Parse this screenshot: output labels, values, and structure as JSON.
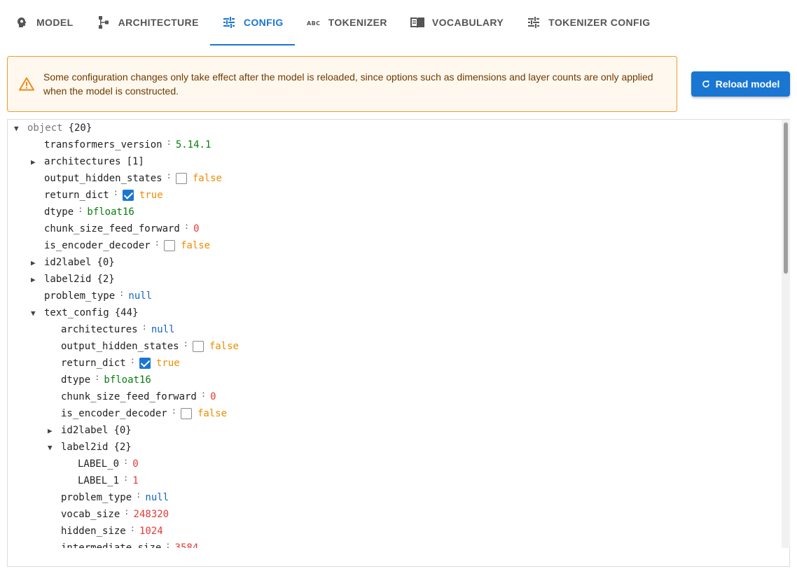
{
  "tabs": [
    {
      "label": "MODEL",
      "icon": "head-gear-icon",
      "active": false
    },
    {
      "label": "ARCHITECTURE",
      "icon": "architecture-icon",
      "active": false
    },
    {
      "label": "CONFIG",
      "icon": "tune-icon",
      "active": true
    },
    {
      "label": "TOKENIZER",
      "icon": "abc-icon",
      "active": false
    },
    {
      "label": "VOCABULARY",
      "icon": "book-icon",
      "active": false
    },
    {
      "label": "TOKENIZER CONFIG",
      "icon": "tune-icon",
      "active": false
    }
  ],
  "warning": {
    "icon": "warning-icon",
    "text": "Some configuration changes only take effect after the model is reloaded, since options such as dimensions and layer counts are only applied when the model is constructed."
  },
  "reload_button": {
    "label": "Reload model",
    "icon": "refresh-icon"
  },
  "colors": {
    "accent": "#1976d2",
    "warning_border": "#ef9a2a",
    "string": "#0a7d10",
    "number": "#e53935",
    "null": "#1565c0",
    "boolean": "#f08c00"
  },
  "tree": [
    {
      "depth": 0,
      "arrow": "expanded",
      "key": "object",
      "meta": "{20}",
      "root": true
    },
    {
      "depth": 1,
      "key": "transformers_version",
      "type": "string",
      "value": "5.14.1"
    },
    {
      "depth": 1,
      "arrow": "collapsed",
      "key": "architectures",
      "meta": "[1]"
    },
    {
      "depth": 1,
      "key": "output_hidden_states",
      "type": "boolean",
      "checked": false,
      "value": "false"
    },
    {
      "depth": 1,
      "key": "return_dict",
      "type": "boolean",
      "checked": true,
      "value": "true"
    },
    {
      "depth": 1,
      "key": "dtype",
      "type": "string",
      "value": "bfloat16"
    },
    {
      "depth": 1,
      "key": "chunk_size_feed_forward",
      "type": "number",
      "value": "0"
    },
    {
      "depth": 1,
      "key": "is_encoder_decoder",
      "type": "boolean",
      "checked": false,
      "value": "false"
    },
    {
      "depth": 1,
      "arrow": "collapsed",
      "key": "id2label",
      "meta": "{0}"
    },
    {
      "depth": 1,
      "arrow": "collapsed",
      "key": "label2id",
      "meta": "{2}"
    },
    {
      "depth": 1,
      "key": "problem_type",
      "type": "null",
      "value": "null"
    },
    {
      "depth": 1,
      "arrow": "expanded",
      "key": "text_config",
      "meta": "{44}"
    },
    {
      "depth": 2,
      "key": "architectures",
      "type": "null",
      "value": "null"
    },
    {
      "depth": 2,
      "key": "output_hidden_states",
      "type": "boolean",
      "checked": false,
      "value": "false"
    },
    {
      "depth": 2,
      "key": "return_dict",
      "type": "boolean",
      "checked": true,
      "value": "true"
    },
    {
      "depth": 2,
      "key": "dtype",
      "type": "string",
      "value": "bfloat16"
    },
    {
      "depth": 2,
      "key": "chunk_size_feed_forward",
      "type": "number",
      "value": "0"
    },
    {
      "depth": 2,
      "key": "is_encoder_decoder",
      "type": "boolean",
      "checked": false,
      "value": "false"
    },
    {
      "depth": 2,
      "arrow": "collapsed",
      "key": "id2label",
      "meta": "{0}"
    },
    {
      "depth": 2,
      "arrow": "expanded",
      "key": "label2id",
      "meta": "{2}"
    },
    {
      "depth": 3,
      "key": "LABEL_0",
      "type": "number",
      "value": "0"
    },
    {
      "depth": 3,
      "key": "LABEL_1",
      "type": "number",
      "value": "1"
    },
    {
      "depth": 2,
      "key": "problem_type",
      "type": "null",
      "value": "null"
    },
    {
      "depth": 2,
      "key": "vocab_size",
      "type": "number",
      "value": "248320"
    },
    {
      "depth": 2,
      "key": "hidden_size",
      "type": "number",
      "value": "1024"
    },
    {
      "depth": 2,
      "key": "intermediate_size",
      "type": "number",
      "value": "3584"
    }
  ]
}
